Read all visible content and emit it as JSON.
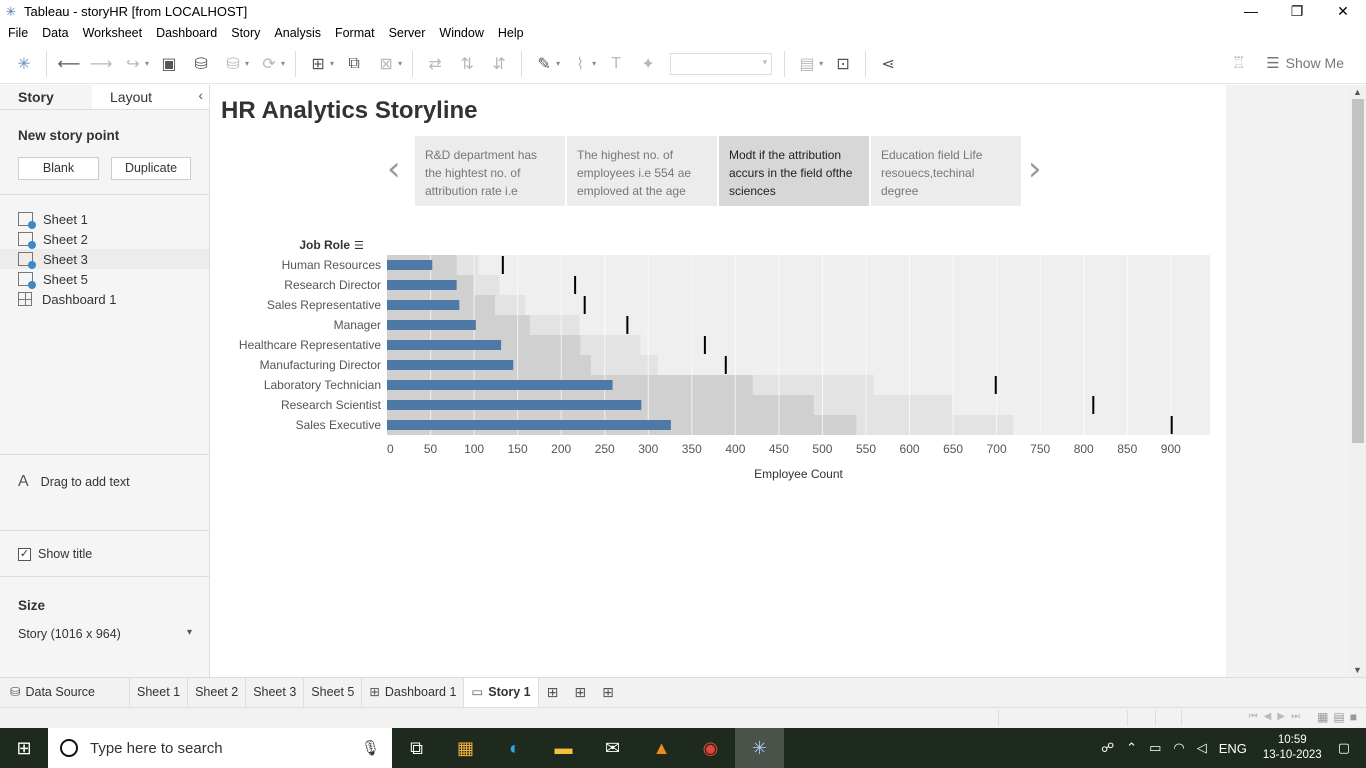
{
  "window": {
    "title": "Tableau - storyHR [from LOCALHOST]",
    "controls": {
      "minimize": "—",
      "restore": "❐",
      "close": "✕"
    }
  },
  "menu": [
    "File",
    "Data",
    "Worksheet",
    "Dashboard",
    "Story",
    "Analysis",
    "Format",
    "Server",
    "Window",
    "Help"
  ],
  "toolbar": {
    "show_me": "Show Me"
  },
  "left_panel": {
    "tab_story": "Story",
    "tab_layout": "Layout",
    "new_story_point": "New story point",
    "blank": "Blank",
    "duplicate": "Duplicate",
    "sheets": [
      {
        "label": "Sheet 1",
        "type": "sheet"
      },
      {
        "label": "Sheet 2",
        "type": "sheet"
      },
      {
        "label": "Sheet 3",
        "type": "sheet"
      },
      {
        "label": "Sheet 5",
        "type": "sheet"
      },
      {
        "label": "Dashboard 1",
        "type": "dashboard"
      }
    ],
    "drag_text": "Drag to add text",
    "show_title": "Show title",
    "show_title_checked": true,
    "size_label": "Size",
    "size_value": "Story (1016 x 964)"
  },
  "story": {
    "title": "HR Analytics Storyline",
    "points": [
      {
        "text": "R&D department has the hightest  no. of attribution rate i.e",
        "active": false
      },
      {
        "text": "The highest no. of employees i.e 554 ae emploved at the age",
        "active": false
      },
      {
        "text": "Modt  if the attribution accurs in the field ofthe sciences",
        "active": true
      },
      {
        "text": "Education field Life resouecs,techinal degree",
        "active": false
      }
    ]
  },
  "chart_data": {
    "type": "bar",
    "title": "",
    "row_header": "Job Role",
    "xlabel": "Employee Count",
    "xlim": [
      0,
      945
    ],
    "x_ticks": [
      0,
      50,
      100,
      150,
      200,
      250,
      300,
      350,
      400,
      450,
      500,
      550,
      600,
      650,
      700,
      750,
      800,
      850,
      900
    ],
    "categories": [
      "Human Resources",
      "Research Director",
      "Sales Representative",
      "Manager",
      "Healthcare Representative",
      "Manufacturing Director",
      "Laboratory Technician",
      "Research Scientist",
      "Sales Executive"
    ],
    "values": [
      52,
      80,
      83,
      102,
      131,
      145,
      259,
      292,
      326
    ],
    "reference_lines": [
      133,
      216,
      227,
      276,
      365,
      389,
      699,
      811,
      901
    ],
    "bands": [
      [
        80,
        105,
        0
      ],
      [
        100,
        129,
        0
      ],
      [
        124,
        159,
        0
      ],
      [
        164,
        221,
        0
      ],
      [
        222,
        291,
        0
      ],
      [
        234,
        311,
        0
      ],
      [
        420,
        559,
        0
      ],
      [
        490,
        649,
        0
      ],
      [
        539,
        719,
        0
      ]
    ],
    "colors": {
      "bar": "#4e79a7",
      "band_light": "#e3e3e3",
      "band_mid": "#d0d0d0",
      "band_dark": "#c2c2c2",
      "ref_line": "#000000",
      "background": "#efefef"
    }
  },
  "bottom_tabs": {
    "data_source": "Data Source",
    "tabs": [
      "Sheet 1",
      "Sheet 2",
      "Sheet 3",
      "Sheet 5",
      "Dashboard 1",
      "Story 1"
    ],
    "active": "Story 1"
  },
  "taskbar": {
    "search_placeholder": "Type here to search",
    "lang": "ENG",
    "time": "10:59",
    "date": "13-10-2023"
  }
}
